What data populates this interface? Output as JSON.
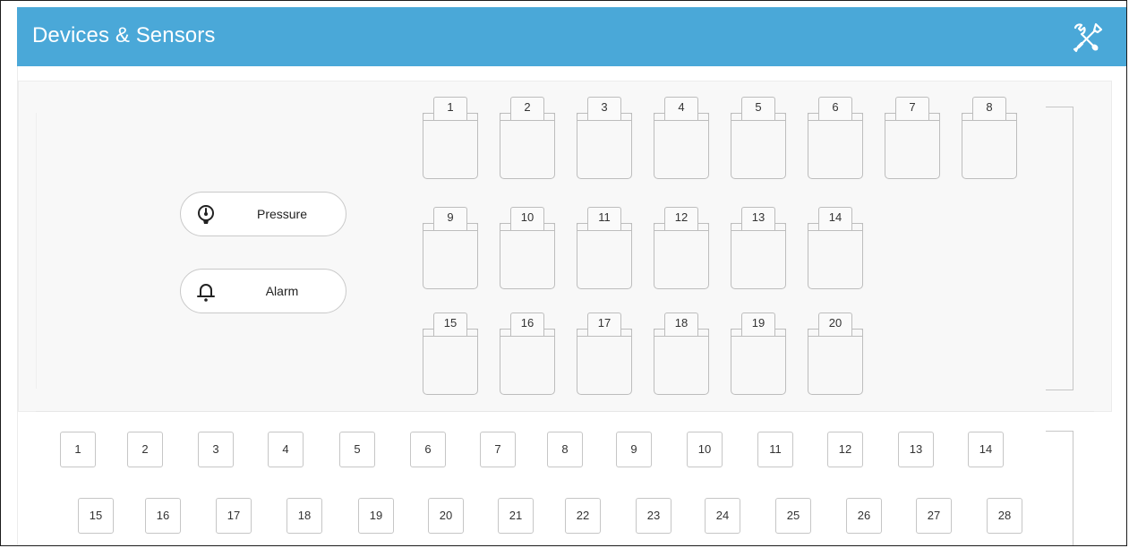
{
  "header": {
    "title": "Devices & Sensors",
    "tools_icon": "tools-icon",
    "color": "#4aa8d8"
  },
  "buttons": {
    "pressure": {
      "label": "Pressure",
      "icon": "pressure-gauge-icon"
    },
    "alarm": {
      "label": "Alarm",
      "icon": "bell-icon"
    }
  },
  "devices": {
    "row1": [
      "1",
      "2",
      "3",
      "4",
      "5",
      "6",
      "7",
      "8"
    ],
    "row2": [
      "9",
      "10",
      "11",
      "12",
      "13",
      "14"
    ],
    "row3": [
      "15",
      "16",
      "17",
      "18",
      "19",
      "20"
    ]
  },
  "ports": {
    "row1": [
      "1",
      "2",
      "3",
      "4",
      "5",
      "6",
      "7",
      "8",
      "9",
      "10",
      "11",
      "12",
      "13",
      "14"
    ],
    "row2": [
      "15",
      "16",
      "17",
      "18",
      "19",
      "20",
      "21",
      "22",
      "23",
      "24",
      "25",
      "26",
      "27",
      "28"
    ]
  }
}
